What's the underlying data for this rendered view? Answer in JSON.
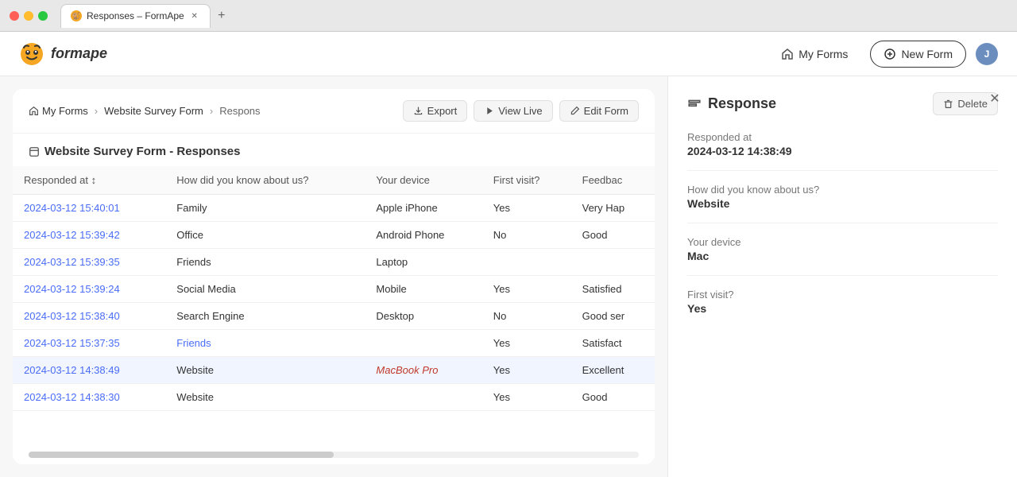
{
  "browser": {
    "tab_title": "Responses – FormApe",
    "new_tab_icon": "+"
  },
  "header": {
    "logo_text": "formape",
    "my_forms_label": "My Forms",
    "new_form_label": "New Form",
    "avatar_initials": "J"
  },
  "breadcrumb": {
    "home_label": "My Forms",
    "form_label": "Website Survey Form",
    "current_label": "Respons",
    "export_label": "Export",
    "view_live_label": "View Live",
    "edit_form_label": "Edit Form"
  },
  "table": {
    "title": "Website Survey Form - Responses",
    "columns": [
      "Responded at",
      "How did you know about us?",
      "Your device",
      "First visit?",
      "Feedbac"
    ],
    "rows": [
      {
        "date": "2024-03-12 15:40:01",
        "source": "Family",
        "device": "Apple iPhone",
        "first_visit": "Yes",
        "feedback": "Very Hap",
        "selected": false
      },
      {
        "date": "2024-03-12 15:39:42",
        "source": "Office",
        "device": "Android Phone",
        "first_visit": "No",
        "feedback": "Good",
        "selected": false
      },
      {
        "date": "2024-03-12 15:39:35",
        "source": "Friends",
        "device": "Laptop",
        "first_visit": "",
        "feedback": "",
        "selected": false
      },
      {
        "date": "2024-03-12 15:39:24",
        "source": "Social Media",
        "device": "Mobile",
        "first_visit": "Yes",
        "feedback": "Satisfied",
        "selected": false
      },
      {
        "date": "2024-03-12 15:38:40",
        "source": "Search Engine",
        "device": "Desktop",
        "first_visit": "No",
        "feedback": "Good ser",
        "selected": false
      },
      {
        "date": "2024-03-12 15:37:35",
        "source": "Friends",
        "device": "",
        "first_visit": "Yes",
        "feedback": "Satisfact",
        "selected": false,
        "source_link": true
      },
      {
        "date": "2024-03-12 14:38:49",
        "source": "Website",
        "device": "MacBook Pro",
        "first_visit": "Yes",
        "feedback": "Excellent",
        "selected": true,
        "device_link": true
      },
      {
        "date": "2024-03-12 14:38:30",
        "source": "Website",
        "device": "",
        "first_visit": "Yes",
        "feedback": "Good",
        "selected": false
      }
    ]
  },
  "response_panel": {
    "title": "Response",
    "delete_label": "Delete",
    "responded_at_label": "Responded at",
    "responded_at_value": "2024-03-12 14:38:49",
    "how_label": "How did you know about us?",
    "how_value": "Website",
    "device_label": "Your device",
    "device_value": "Mac",
    "first_visit_label": "First visit?",
    "first_visit_value": "Yes"
  }
}
